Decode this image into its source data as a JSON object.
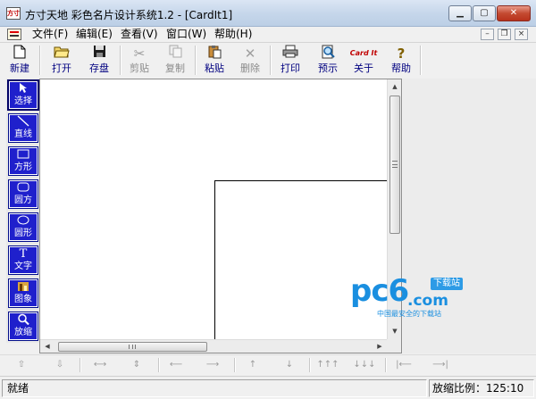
{
  "window": {
    "title": "方寸天地  彩色名片设计系统1.2 - [CardIt1]",
    "icon_label": "方寸",
    "controls": {
      "minimize_icon": "minimize-icon",
      "maximize_icon": "maximize-icon",
      "close_icon": "close-icon"
    }
  },
  "menu": {
    "items": [
      {
        "label": "文件(F)"
      },
      {
        "label": "编辑(E)"
      },
      {
        "label": "查看(V)"
      },
      {
        "label": "窗口(W)"
      },
      {
        "label": "帮助(H)"
      }
    ],
    "mdi_controls": {
      "minimize": "–",
      "restore": "❐",
      "close": "×"
    }
  },
  "toolbar": {
    "buttons": [
      {
        "label": "新建",
        "icon": "new-document-icon",
        "enabled": true
      },
      {
        "label": "打开",
        "icon": "open-folder-icon",
        "enabled": true
      },
      {
        "label": "存盘",
        "icon": "save-disk-icon",
        "enabled": true
      },
      {
        "label": "剪贴",
        "icon": "scissors-icon",
        "enabled": false
      },
      {
        "label": "复制",
        "icon": "copy-icon",
        "enabled": false
      },
      {
        "label": "粘贴",
        "icon": "paste-clipboard-icon",
        "enabled": true
      },
      {
        "label": "删除",
        "icon": "delete-x-icon",
        "enabled": false
      },
      {
        "label": "打印",
        "icon": "printer-icon",
        "enabled": true
      },
      {
        "label": "预示",
        "icon": "print-preview-icon",
        "enabled": true
      },
      {
        "label": "关于",
        "icon": "card-logo-icon",
        "logo_text": "Card It",
        "enabled": true
      },
      {
        "label": "帮助",
        "icon": "help-question-icon",
        "enabled": true
      }
    ],
    "colors": {
      "enabled_text": "#000080",
      "disabled_text": "#8a8a8a"
    }
  },
  "palette": {
    "tools": [
      {
        "label": "选择",
        "icon": "select-arrow-icon",
        "active": true
      },
      {
        "label": "直线",
        "icon": "line-icon",
        "active": false
      },
      {
        "label": "方形",
        "icon": "rectangle-icon",
        "active": false
      },
      {
        "label": "圆方",
        "icon": "rounded-rectangle-icon",
        "active": false
      },
      {
        "label": "圆形",
        "icon": "ellipse-icon",
        "active": false
      },
      {
        "label": "文字",
        "icon": "text-icon",
        "glyph": "T",
        "active": false
      },
      {
        "label": "图象",
        "icon": "image-icon",
        "active": false
      },
      {
        "label": "放缩",
        "icon": "zoom-magnifier-icon",
        "active": false
      }
    ],
    "colors": {
      "button": "#1f20cc",
      "text": "#ffffff"
    }
  },
  "alignbar": {
    "buttons": [
      {
        "icon": "align-top-icon",
        "glyph": "⇧"
      },
      {
        "icon": "align-bottom-icon",
        "glyph": "⇩"
      },
      {
        "icon": "stretch-horizontal-icon",
        "glyph": "⟷"
      },
      {
        "icon": "stretch-vertical-icon",
        "glyph": "⇕"
      },
      {
        "icon": "align-left-icon",
        "glyph": "⟵"
      },
      {
        "icon": "align-right-icon",
        "glyph": "⟶"
      },
      {
        "icon": "move-up-icon",
        "glyph": "↑"
      },
      {
        "icon": "move-down-icon",
        "glyph": "↓"
      },
      {
        "icon": "distribute-up-icon",
        "glyph": "↑↑↑"
      },
      {
        "icon": "distribute-down-icon",
        "glyph": "↓↓↓"
      },
      {
        "icon": "distribute-left-icon",
        "glyph": "|⟵"
      },
      {
        "icon": "distribute-right-icon",
        "glyph": "⟶|"
      }
    ]
  },
  "watermark": {
    "logo": "pc6",
    "domain": ".com",
    "badge": "下载站",
    "slogan": "中国最安全的下载站"
  },
  "status": {
    "left": "就绪",
    "right": "放缩比例：125:10"
  }
}
